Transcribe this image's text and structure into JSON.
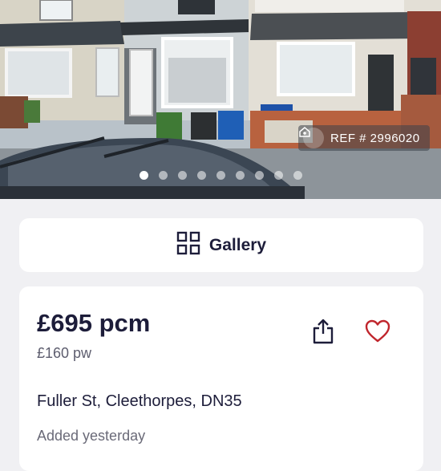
{
  "listing": {
    "reference_label": "REF # 2996020",
    "photo_count": 9,
    "active_photo": 0,
    "gallery_label": "Gallery",
    "price": "£695 pcm",
    "price_weekly": "£160 pw",
    "address": "Fuller St, Cleethorpes, DN35",
    "added": "Added yesterday"
  },
  "icons": {
    "reference": "house-eye-icon",
    "gallery": "grid-icon",
    "share": "share-icon",
    "favourite": "heart-icon"
  },
  "colors": {
    "text_primary": "#1d1d3a",
    "text_secondary": "#5d5d6e",
    "favourite": "#c0262d",
    "page_background": "#f0f0f3"
  }
}
